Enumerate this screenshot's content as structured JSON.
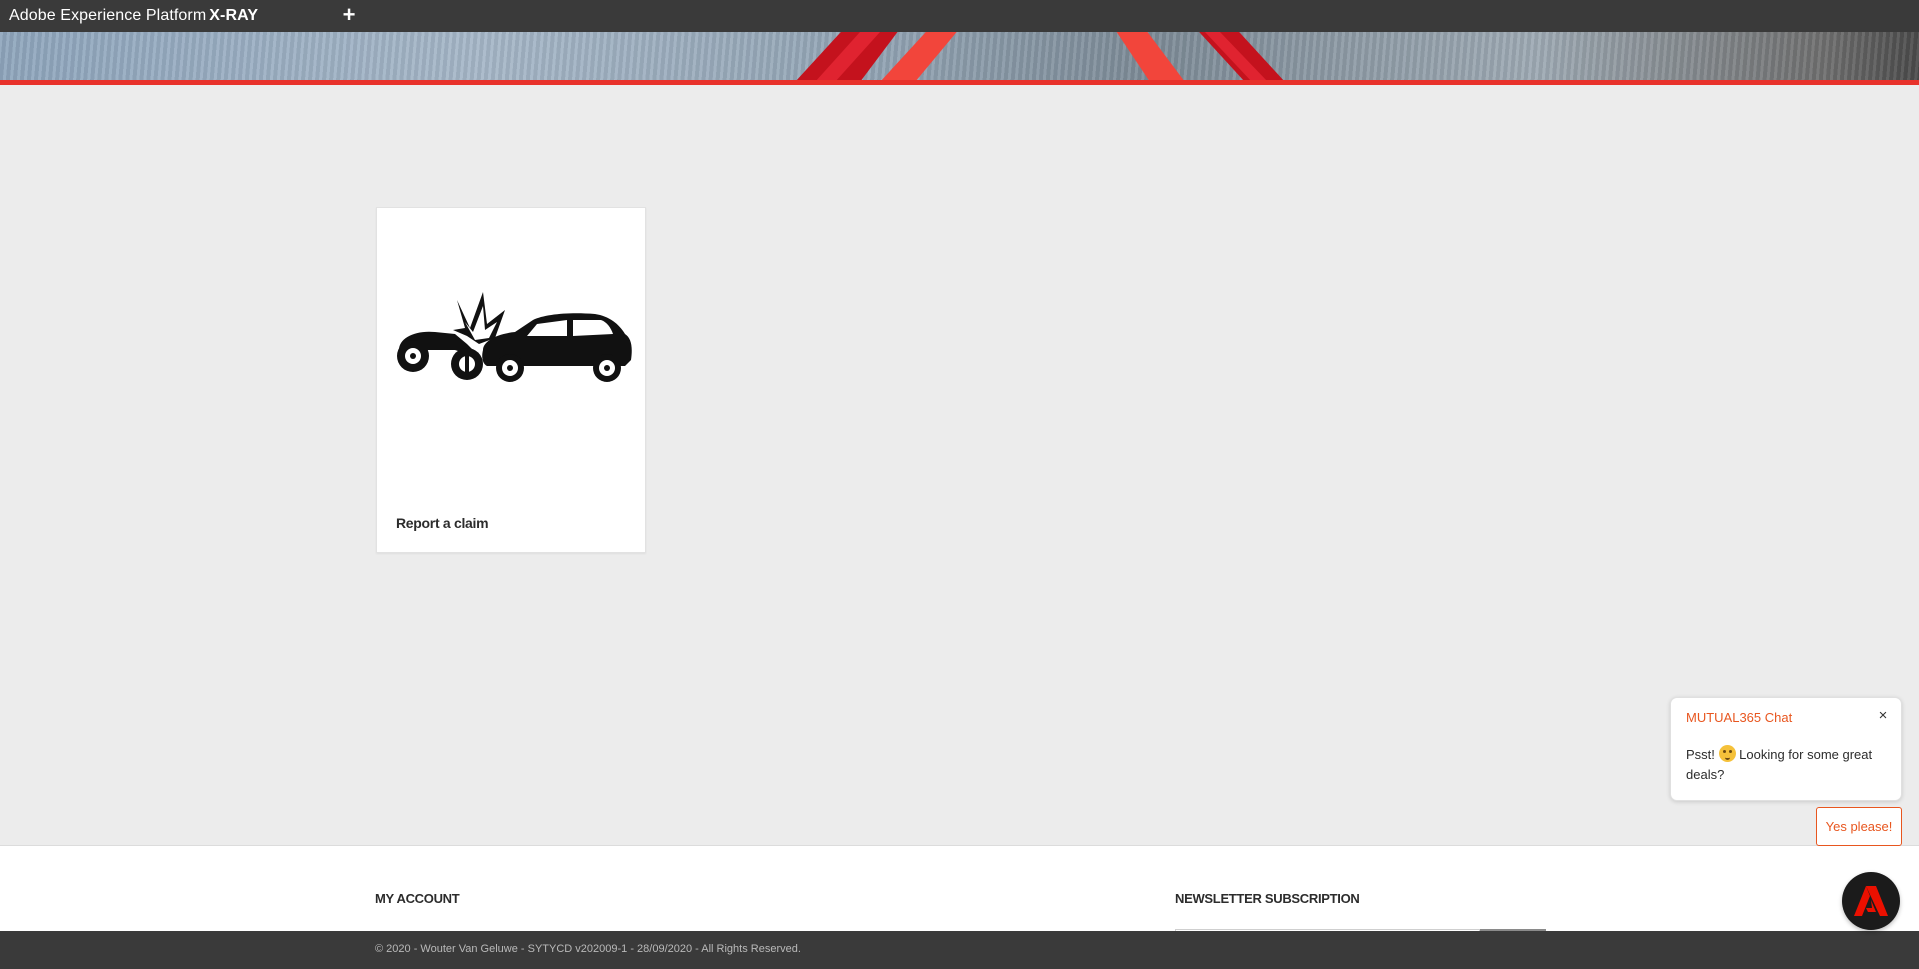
{
  "xray_bar": {
    "title_prefix": "Adobe Experience Platform",
    "title_strong": "X-RAY",
    "add_label": "+"
  },
  "card": {
    "label": "Report a claim",
    "icon": "car-crash-icon"
  },
  "footer": {
    "my_account_heading": "MY ACCOUNT",
    "newsletter_heading": "NEWSLETTER SUBSCRIPTION",
    "copyright": "© 2020 - Wouter Van Geluwe - SYTYCD v202009-1 - 28/09/2020 - All Rights Reserved."
  },
  "chat": {
    "title": "MUTUAL365 Chat",
    "close_label": "×",
    "message_before": "Psst!",
    "message_after": "Looking for some great deals?",
    "emoji": "face-emoji-icon",
    "cta_label": "Yes please!",
    "launcher_icon": "adobe-logo-icon"
  },
  "colors": {
    "accent_red": "#e8322b",
    "chat_orange": "#e8561f",
    "dark_bar": "#3a3a3a",
    "background": "#ececec"
  }
}
